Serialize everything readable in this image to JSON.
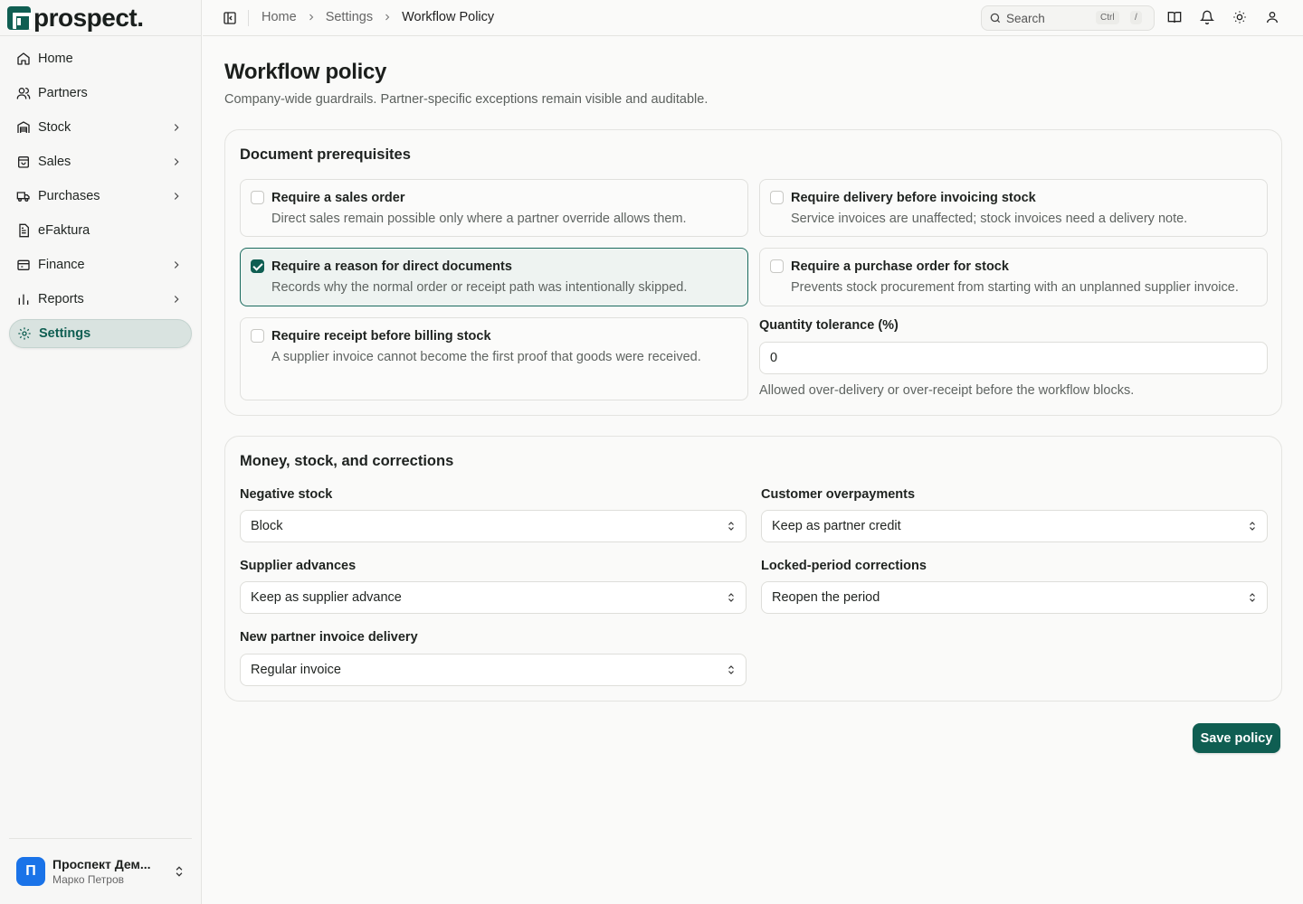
{
  "app": {
    "logo_text": "prospect."
  },
  "sidebar": {
    "items": [
      {
        "label": "Home",
        "icon": "home-icon",
        "chevron": false
      },
      {
        "label": "Partners",
        "icon": "users-icon",
        "chevron": false
      },
      {
        "label": "Stock",
        "icon": "warehouse-icon",
        "chevron": true
      },
      {
        "label": "Sales",
        "icon": "shopping-bag-icon",
        "chevron": true
      },
      {
        "label": "Purchases",
        "icon": "truck-icon",
        "chevron": true
      },
      {
        "label": "eFaktura",
        "icon": "file-text-icon",
        "chevron": false
      },
      {
        "label": "Finance",
        "icon": "wallet-icon",
        "chevron": true
      },
      {
        "label": "Reports",
        "icon": "bar-chart-icon",
        "chevron": true
      },
      {
        "label": "Settings",
        "icon": "gear-icon",
        "chevron": false,
        "active": true
      }
    ],
    "account": {
      "avatar": "П",
      "name": "Проспект Дем...",
      "user": "Марко Петров"
    }
  },
  "topbar": {
    "breadcrumb": [
      "Home",
      "Settings",
      "Workflow Policy"
    ],
    "search": {
      "label": "Search",
      "kbd1": "Ctrl",
      "kbd2": "/"
    }
  },
  "page": {
    "title": "Workflow policy",
    "subtitle": "Company-wide guardrails. Partner-specific exceptions remain visible and auditable."
  },
  "prereq": {
    "title": "Document prerequisites",
    "options": [
      {
        "title": "Require a sales order",
        "desc": "Direct sales remain possible only where a partner override allows them.",
        "checked": false
      },
      {
        "title": "Require delivery before invoicing stock",
        "desc": "Service invoices are unaffected; stock invoices need a delivery note.",
        "checked": false
      },
      {
        "title": "Require a reason for direct documents",
        "desc": "Records why the normal order or receipt path was intentionally skipped.",
        "checked": true
      },
      {
        "title": "Require a purchase order for stock",
        "desc": "Prevents stock procurement from starting with an unplanned supplier invoice.",
        "checked": false
      },
      {
        "title": "Require receipt before billing stock",
        "desc": "A supplier invoice cannot become the first proof that goods were received.",
        "checked": false
      }
    ],
    "tolerance": {
      "label": "Quantity tolerance (%)",
      "value": "0",
      "help": "Allowed over-delivery or over-receipt before the workflow blocks."
    }
  },
  "money": {
    "title": "Money, stock, and corrections",
    "fields": [
      {
        "label": "Negative stock",
        "value": "Block"
      },
      {
        "label": "Customer overpayments",
        "value": "Keep as partner credit"
      },
      {
        "label": "Supplier advances",
        "value": "Keep as supplier advance"
      },
      {
        "label": "Locked-period corrections",
        "value": "Reopen the period"
      },
      {
        "label": "New partner invoice delivery",
        "value": "Regular invoice"
      }
    ]
  },
  "actions": {
    "save": "Save policy"
  },
  "colors": {
    "accent": "#0f5e52",
    "avatar": "#1a73e8"
  }
}
